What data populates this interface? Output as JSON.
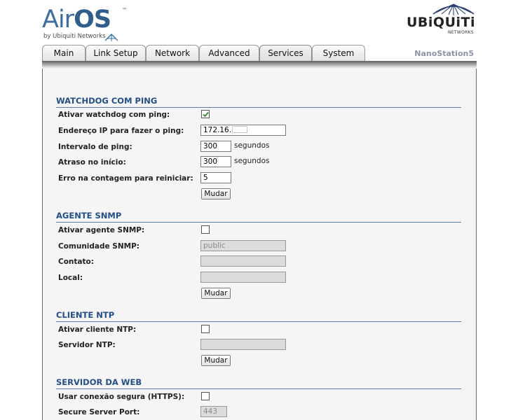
{
  "header": {
    "brand_air": "Air",
    "brand_os": "OS",
    "brand_tm": "™",
    "brand_sub": "by Ubiquiti Networks",
    "vendor_name": "UBiQUiTi",
    "vendor_sub": "NETWORKS",
    "device_name": "NanoStation5"
  },
  "tabs": [
    {
      "label": "Main"
    },
    {
      "label": "Link Setup"
    },
    {
      "label": "Network"
    },
    {
      "label": "Advanced"
    },
    {
      "label": "Services",
      "active": true
    },
    {
      "label": "System"
    }
  ],
  "watchdog": {
    "title": "WATCHDOG COM PING",
    "enable_label": "Ativar watchdog com ping:",
    "enable_checked": true,
    "ip_label": "Endereço IP para fazer o ping:",
    "ip_value": "172.16.",
    "interval_label": "Intervalo de ping:",
    "interval_value": "300",
    "interval_unit": "segundos",
    "delay_label": "Atraso no início:",
    "delay_value": "300",
    "delay_unit": "segundos",
    "failure_label": "Erro na contagem para reiniciar:",
    "failure_value": "5",
    "button": "Mudar"
  },
  "snmp": {
    "title": "AGENTE SNMP",
    "enable_label": "Ativar agente SNMP:",
    "enable_checked": false,
    "community_label": "Comunidade SNMP:",
    "community_value": "public",
    "contact_label": "Contato:",
    "contact_value": "",
    "location_label": "Local:",
    "location_value": "",
    "button": "Mudar"
  },
  "ntp": {
    "title": "CLIENTE NTP",
    "enable_label": "Ativar cliente NTP:",
    "enable_checked": false,
    "server_label": "Servidor NTP:",
    "server_value": "",
    "button": "Mudar"
  },
  "web": {
    "title": "SERVIDOR DA WEB",
    "https_label": "Usar conexão segura (HTTPS):",
    "https_checked": false,
    "port_label": "Secure Server Port:",
    "port_value": "443"
  },
  "colors": {
    "section_title": "#244e86",
    "brand_blue": "#3c6fa0",
    "check_green": "#2f8a2f",
    "device_name": "#8b94a6"
  }
}
